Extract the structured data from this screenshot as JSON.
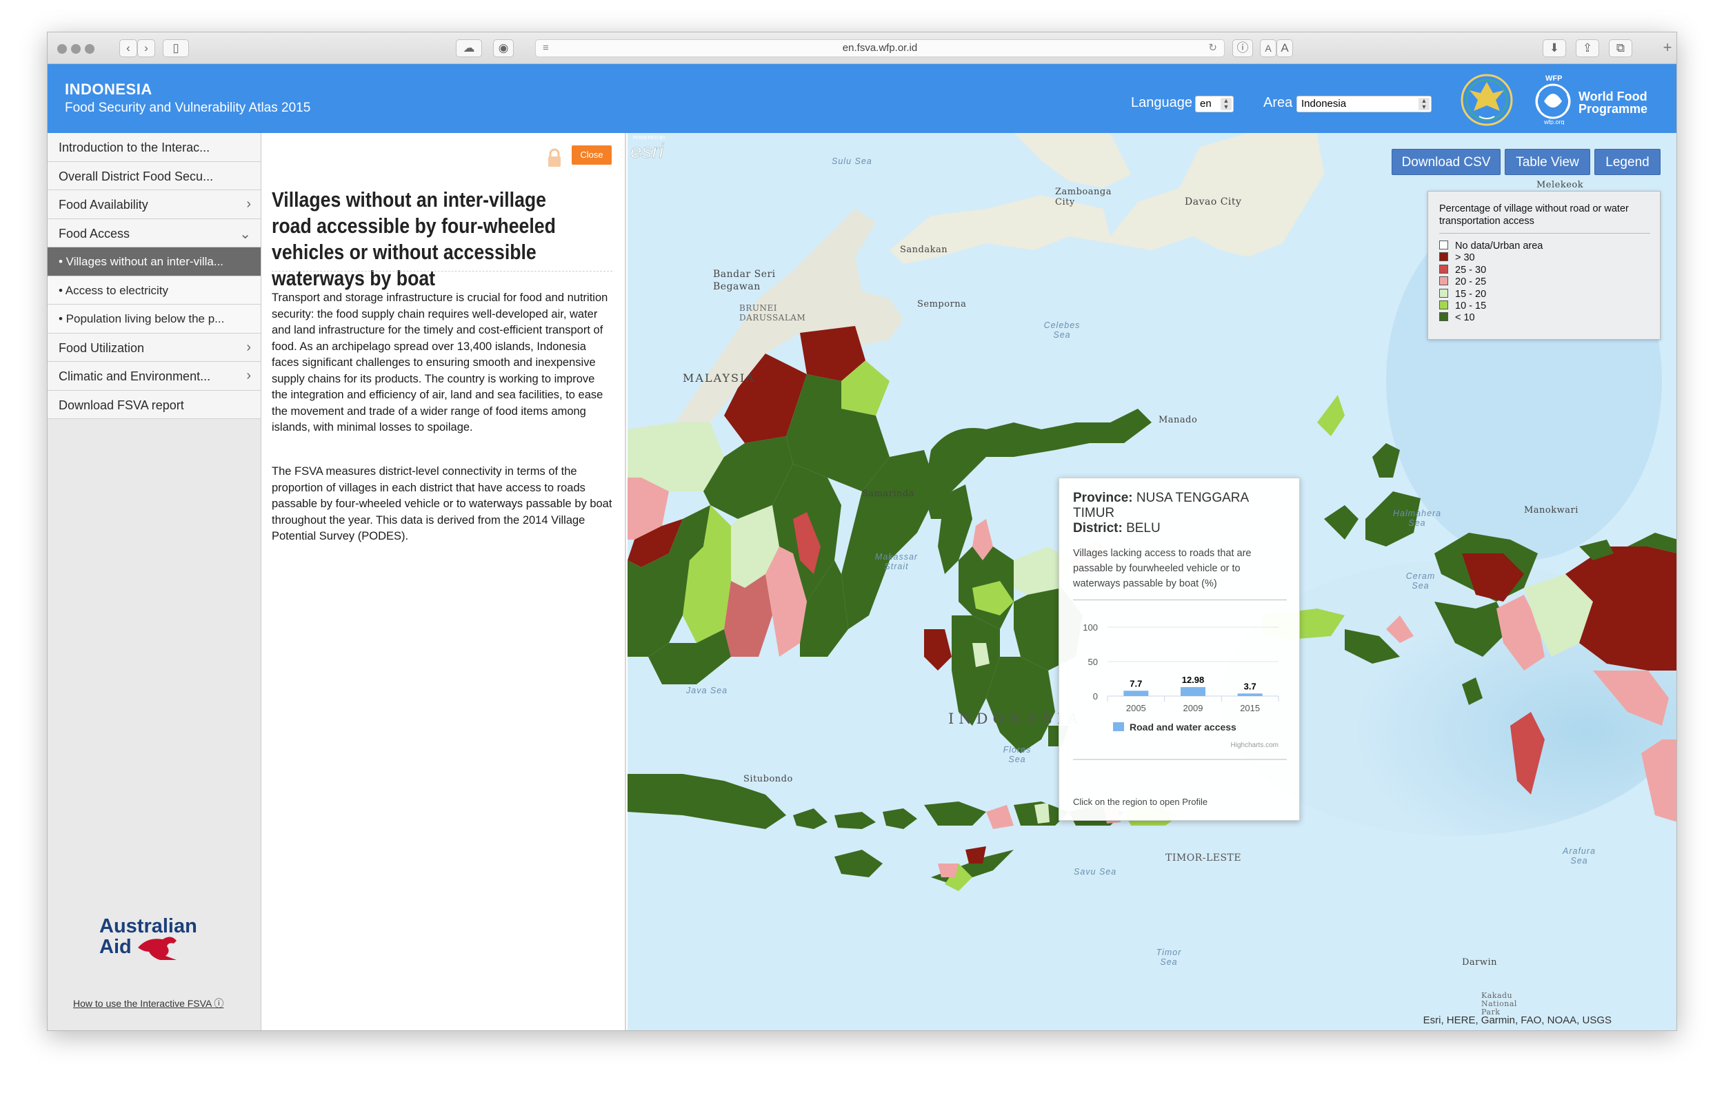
{
  "browser": {
    "url": "en.fsva.wfp.or.id",
    "reader_a_small": "A",
    "reader_a_large": "A"
  },
  "header": {
    "title": "INDONESIA",
    "subtitle": "Food Security and Vulnerability Atlas 2015",
    "language_label": "Language",
    "language_value": "en",
    "area_label": "Area",
    "area_value": "Indonesia",
    "wfp_small": "WFP",
    "wfp_name_line1": "World Food",
    "wfp_name_line2": "Programme",
    "wfp_url": "wfp.org"
  },
  "sidebar": {
    "items": [
      {
        "label": "Introduction to the Interac...",
        "type": "top",
        "chevron": ""
      },
      {
        "label": "Overall District Food Secu...",
        "type": "top",
        "chevron": ""
      },
      {
        "label": "Food Availability",
        "type": "top",
        "chevron": "›"
      },
      {
        "label": "Food Access",
        "type": "top",
        "chevron": "⌄"
      },
      {
        "label": "• Villages without an inter-villa...",
        "type": "sub-active",
        "chevron": ""
      },
      {
        "label": "• Access to electricity",
        "type": "sub",
        "chevron": ""
      },
      {
        "label": "• Population living below the p...",
        "type": "sub",
        "chevron": ""
      },
      {
        "label": "Food Utilization",
        "type": "top",
        "chevron": "›"
      },
      {
        "label": "Climatic and Environment...",
        "type": "top",
        "chevron": "›"
      },
      {
        "label": "Download FSVA report",
        "type": "top",
        "chevron": ""
      }
    ],
    "aid_logo_line1": "Australian",
    "aid_logo_line2": "Aid",
    "howto_link": "How to use the Interactive FSVA"
  },
  "panel": {
    "close_label": "Close",
    "title": "Villages without an inter-village road accessible by four-wheeled vehicles or without accessible waterways by boat",
    "paragraph1": "Transport and storage infrastructure is crucial for food and nutrition security: the food supply chain requires well-developed air, water and land infrastructure for the timely and cost-efficient transport of food. As an archipelago spread over 13,400 islands, Indonesia faces significant challenges to ensuring smooth and inexpensive supply chains for its products. The country is working to improve the integration and efficiency of air, land and sea facilities, to ease the movement and trade of a wider range of food items among islands, with minimal losses to spoilage.",
    "paragraph2": "The FSVA measures district-level connectivity in terms of the proportion of villages in each district that have access to roads passable by four-wheeled vehicle or to waterways passable by boat throughout the year. This data is derived from the 2014 Village Potential Survey (PODES)."
  },
  "map": {
    "buttons": {
      "csv": "Download CSV",
      "table": "Table View",
      "legend": "Legend"
    },
    "legend": {
      "title": "Percentage of village without road or water transportation access",
      "items": [
        {
          "label": "No data/Urban area",
          "color": "#ffffff"
        },
        {
          "label": "> 30",
          "color": "#8b1a10"
        },
        {
          "label": "25 - 30",
          "color": "#cc4b4b"
        },
        {
          "label": "20 - 25",
          "color": "#efa5a5"
        },
        {
          "label": "15 - 20",
          "color": "#d7edc4"
        },
        {
          "label": "10 - 15",
          "color": "#a3d74e"
        },
        {
          "label": "< 10",
          "color": "#3b6b1f"
        }
      ]
    },
    "places": {
      "sulu_sea": "Sulu Sea",
      "zamboanga": "Zamboanga City",
      "davao": "Davao City",
      "sandakan": "Sandakan",
      "bandar": "Bandar Seri Begawan",
      "brunei": "BRUNEI DARUSSALAM",
      "semporna": "Semporna",
      "celebes_sea": "Celebes Sea",
      "malaysia": "MALAYSIA",
      "manado": "Manado",
      "samarinda": "Samarinda",
      "makassar": "Makassar Strait",
      "halmahera": "Halmahera Sea",
      "ceram": "Ceram Sea",
      "manokwari": "Manokwari",
      "java_sea": "Java Sea",
      "indonesia": "INDONESIA",
      "flores": "Flores Sea",
      "situbondo": "Situbondo",
      "timor_leste": "TIMOR-LESTE",
      "savu": "Savu Sea",
      "arafura": "Arafura Sea",
      "timor_sea": "Timor Sea",
      "darwin": "Darwin",
      "kakadu": "Kakadu National Park",
      "melekeok": "Melekeok"
    },
    "attribution": "Esri, HERE, Garmin, FAO, NOAA, USGS",
    "esri_small": "POWERED BY",
    "esri": "esri"
  },
  "tooltip": {
    "province_label": "Province:",
    "province_value": "NUSA TENGGARA TIMUR",
    "district_label": "District:",
    "district_value": "BELU",
    "description": "Villages lacking access to roads that are passable by fourwheeled vehicle or to waterways passable by boat (%)",
    "hint": "Click on the region to open Profile",
    "credit": "Highcharts.com"
  },
  "chart_data": {
    "type": "bar",
    "categories": [
      "2005",
      "2009",
      "2015"
    ],
    "series": [
      {
        "name": "Road and water access",
        "values": [
          7.7,
          12.98,
          3.7
        ],
        "color": "#7cb5ec"
      }
    ],
    "ylim": [
      0,
      100
    ],
    "yticks": [
      0,
      50,
      100
    ],
    "data_labels": [
      "7.7",
      "12.98",
      "3.7"
    ]
  }
}
